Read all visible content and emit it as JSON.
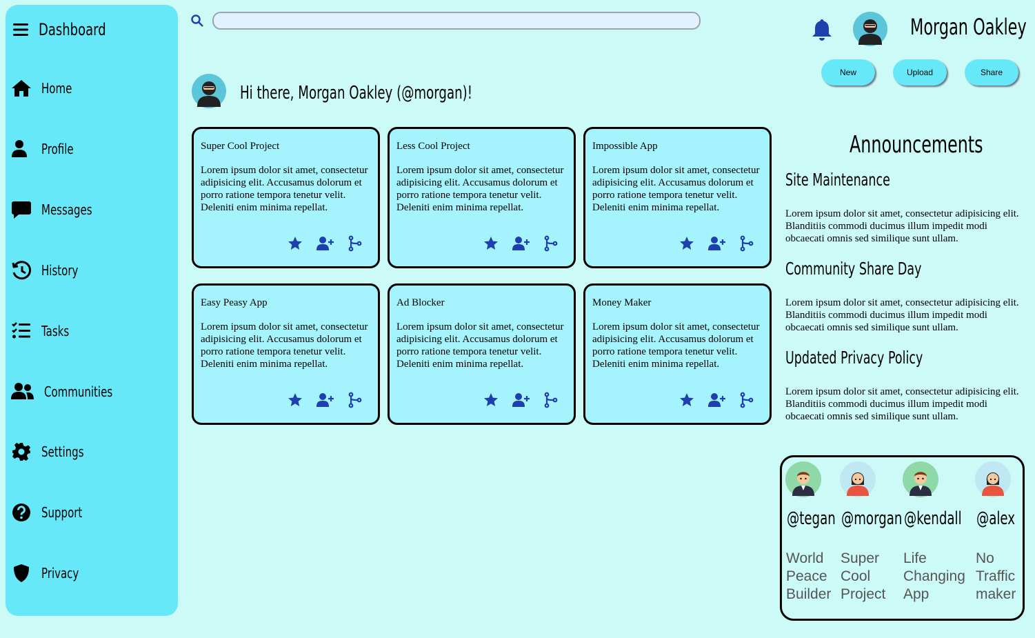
{
  "sidebar": {
    "title": "Dashboard",
    "items": [
      {
        "label": "Home",
        "icon": "home-icon"
      },
      {
        "label": "Profile",
        "icon": "user-icon"
      },
      {
        "label": "Messages",
        "icon": "message-icon"
      },
      {
        "label": "History",
        "icon": "history-icon"
      },
      {
        "label": "Tasks",
        "icon": "tasks-icon"
      },
      {
        "label": "Communities",
        "icon": "users-icon"
      },
      {
        "label": "Settings",
        "icon": "gear-icon"
      },
      {
        "label": "Support",
        "icon": "question-icon"
      },
      {
        "label": "Privacy",
        "icon": "shield-icon"
      }
    ]
  },
  "header": {
    "search_placeholder": "",
    "user_name": "Morgan Oakley",
    "buttons": {
      "new": "New",
      "upload": "Upload",
      "share": "Share"
    }
  },
  "greeting": "Hi there, Morgan Oakley (@morgan)!",
  "projects": [
    {
      "title": "Super Cool Project",
      "body": "Lorem ipsum dolor sit amet, consectetur adipisicing elit. Accusamus dolorum et porro ratione tempora tenetur velit. Deleniti enim minima repellat."
    },
    {
      "title": "Less Cool Project",
      "body": "Lorem ipsum dolor sit amet, consectetur adipisicing elit. Accusamus dolorum et porro ratione tempora tenetur velit. Deleniti enim minima repellat."
    },
    {
      "title": "Impossible App",
      "body": "Lorem ipsum dolor sit amet, consectetur adipisicing elit. Accusamus dolorum et porro ratione tempora tenetur velit. Deleniti enim minima repellat."
    },
    {
      "title": "Easy Peasy App",
      "body": "Lorem ipsum dolor sit amet, consectetur adipisicing elit. Accusamus dolorum et porro ratione tempora tenetur velit. Deleniti enim minima repellat."
    },
    {
      "title": "Ad Blocker",
      "body": "Lorem ipsum dolor sit amet, consectetur adipisicing elit. Accusamus dolorum et porro ratione tempora tenetur velit. Deleniti enim minima repellat."
    },
    {
      "title": "Money Maker",
      "body": "Lorem ipsum dolor sit amet, consectetur adipisicing elit. Accusamus dolorum et porro ratione tempora tenetur velit. Deleniti enim minima repellat."
    }
  ],
  "announcements": {
    "heading": "Announcements",
    "items": [
      {
        "title": "Site Maintenance",
        "body": "Lorem ipsum dolor sit amet, consectetur adipisicing elit. Blanditiis commodi ducimus illum impedit modi obcaecati omnis sed similique sunt ullam."
      },
      {
        "title": "Community Share Day",
        "body": "Lorem ipsum dolor sit amet, consectetur adipisicing elit. Blanditiis commodi ducimus illum impedit modi obcaecati omnis sed similique sunt ullam."
      },
      {
        "title": "Updated Privacy Policy",
        "body": "Lorem ipsum dolor sit amet, consectetur adipisicing elit. Blanditiis commodi ducimus illum impedit modi obcaecati omnis sed similique sunt ullam."
      }
    ]
  },
  "trending": [
    {
      "handle": "@tegan",
      "desc": [
        "World",
        "Peace",
        "Builder"
      ]
    },
    {
      "handle": "@morgan",
      "desc": [
        "Super",
        "Cool",
        "Project"
      ]
    },
    {
      "handle": "@kendall",
      "desc": [
        "Life",
        "Changing",
        "App"
      ]
    },
    {
      "handle": "@alex",
      "desc": [
        "No",
        "Traffic",
        "maker"
      ]
    }
  ],
  "colors": {
    "background": "#ccfbf7",
    "sidebar": "#67e8f9",
    "card": "#a5f3fc",
    "icon": "#1e40af"
  }
}
